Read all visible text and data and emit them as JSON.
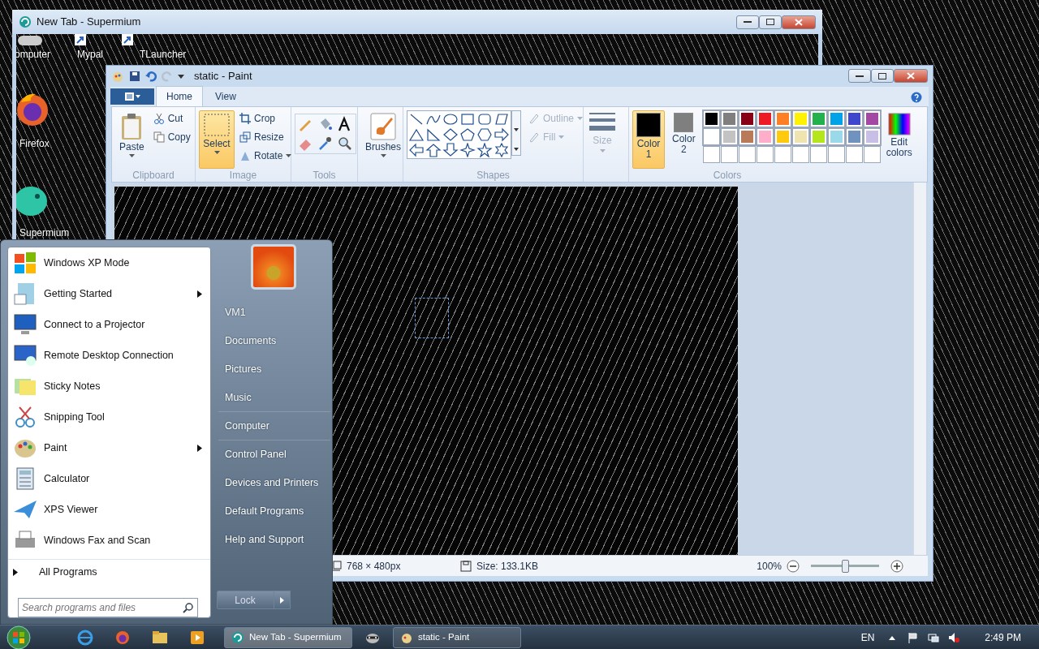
{
  "desktop": {
    "icons": [
      {
        "label": "omputer"
      },
      {
        "label": "Mypal"
      },
      {
        "label": "TLauncher"
      },
      {
        "label": "Firefox"
      },
      {
        "label": "Supermium"
      }
    ]
  },
  "browser_window": {
    "title": "New Tab - Supermium"
  },
  "paint_window": {
    "title": "static - Paint",
    "tabs": [
      {
        "label": "Home",
        "selected": true
      },
      {
        "label": "View",
        "selected": false
      }
    ],
    "clipboard": {
      "paste": "Paste",
      "cut": "Cut",
      "copy": "Copy",
      "label": "Clipboard"
    },
    "image": {
      "select": {
        "label": "Select",
        "selected": true
      },
      "crop": "Crop",
      "resize": "Resize",
      "rotate": "Rotate",
      "label": "Image"
    },
    "tools": {
      "label": "Tools"
    },
    "brushes": {
      "label": "Brushes"
    },
    "shapes": {
      "label": "Shapes",
      "outline": {
        "label": "Outline",
        "disabled": true
      },
      "fill": {
        "label": "Fill",
        "disabled": true
      }
    },
    "size": {
      "label": "Size",
      "disabled": true
    },
    "color_slots": [
      {
        "label": "Color 1",
        "color": "#000000",
        "selected": true
      },
      {
        "label": "Color 2",
        "color": "#7f7f7f",
        "selected": false
      }
    ],
    "palette": [
      {
        "color": "#000000"
      },
      {
        "color": "#7f7f7f"
      },
      {
        "color": "#880015"
      },
      {
        "color": "#ed1c24"
      },
      {
        "color": "#ff7f27"
      },
      {
        "color": "#fff200"
      },
      {
        "color": "#22b14c"
      },
      {
        "color": "#00a2e8"
      },
      {
        "color": "#3f48cc"
      },
      {
        "color": "#a349a4"
      },
      {
        "color": "#ffffff"
      },
      {
        "color": "#c3c3c3"
      },
      {
        "color": "#b97a57"
      },
      {
        "color": "#ffaec9"
      },
      {
        "color": "#ffc90e"
      },
      {
        "color": "#efe4b0"
      },
      {
        "color": "#b5e61d"
      },
      {
        "color": "#99d9ea"
      },
      {
        "color": "#7092be"
      },
      {
        "color": "#c8bfe7"
      }
    ],
    "colors_label": "Colors",
    "edit_colors": "Edit colors",
    "status_bar": {
      "dimensions": "768 × 480px",
      "file_size": "Size: 133.1KB",
      "zoom": "100%",
      "zoom_slider": {
        "level": 0.5
      }
    }
  },
  "start_menu": {
    "programs": [
      {
        "label": "Windows XP Mode",
        "submenu": false
      },
      {
        "label": "Getting Started",
        "submenu": true
      },
      {
        "label": "Connect to a Projector",
        "submenu": false
      },
      {
        "label": "Remote Desktop Connection",
        "submenu": false
      },
      {
        "label": "Sticky Notes",
        "submenu": false
      },
      {
        "label": "Snipping Tool",
        "submenu": false
      },
      {
        "label": "Paint",
        "submenu": true
      },
      {
        "label": "Calculator",
        "submenu": false
      },
      {
        "label": "XPS Viewer",
        "submenu": false
      },
      {
        "label": "Windows Fax and Scan",
        "submenu": false
      }
    ],
    "all_programs": "All Programs",
    "places": [
      {
        "label": "VM1"
      },
      {
        "label": "Documents"
      },
      {
        "label": "Pictures"
      },
      {
        "label": "Music"
      },
      {
        "label": "Computer"
      },
      {
        "label": "Control Panel"
      },
      {
        "label": "Devices and Printers"
      },
      {
        "label": "Default Programs"
      },
      {
        "label": "Help and Support"
      }
    ],
    "search": {
      "placeholder": "Search programs and files"
    },
    "lock": "Lock"
  },
  "taskbar": {
    "tasks": [
      {
        "label": "New Tab - Supermium",
        "selected": true
      },
      {
        "label": "static - Paint",
        "selected": false
      }
    ],
    "language": "EN",
    "clock": "2:49 PM"
  }
}
